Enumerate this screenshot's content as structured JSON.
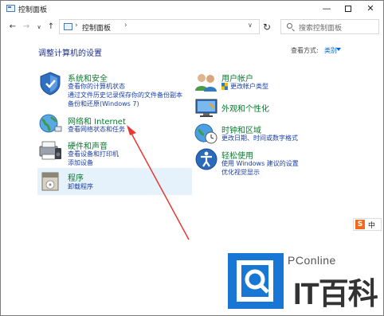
{
  "window": {
    "title": "控制面板"
  },
  "address_bar": {
    "path": "控制面板",
    "search_placeholder": "搜索控制面板"
  },
  "main": {
    "heading": "调整计算机的设置",
    "view_by_label": "查看方式:",
    "view_by_value": "类别"
  },
  "left_categories": [
    {
      "title": "系统和安全",
      "links": [
        "查看你的计算机状态",
        "通过文件历史记录保存你的文件备份副本",
        "备份和还原(Windows 7)"
      ]
    },
    {
      "title": "网络和 Internet",
      "links": [
        "查看网络状态和任务"
      ]
    },
    {
      "title": "硬件和声音",
      "links": [
        "查看设备和打印机",
        "添加设备"
      ]
    },
    {
      "title": "程序",
      "links": [
        "卸载程序"
      ]
    }
  ],
  "right_categories": [
    {
      "title": "用户帐户",
      "links": [
        "更改帐户类型"
      ]
    },
    {
      "title": "外观和个性化",
      "links": []
    },
    {
      "title": "时钟和区域",
      "links": [
        "更改日期、时间或数字格式"
      ]
    },
    {
      "title": "轻松使用",
      "links": [
        "使用 Windows 建议的设置",
        "优化视觉显示"
      ]
    }
  ],
  "overlay": {
    "ime": "中",
    "ime_badge": "S",
    "watermark_top": "PConline",
    "watermark_bottom": "IT百科"
  },
  "colors": {
    "category_title": "#0a7a2e",
    "link": "#1a3fa3",
    "heading": "#1e3287",
    "highlight": "#e5f1fb",
    "arrow": "#e53935",
    "watermark_blue": "#1877d4"
  }
}
